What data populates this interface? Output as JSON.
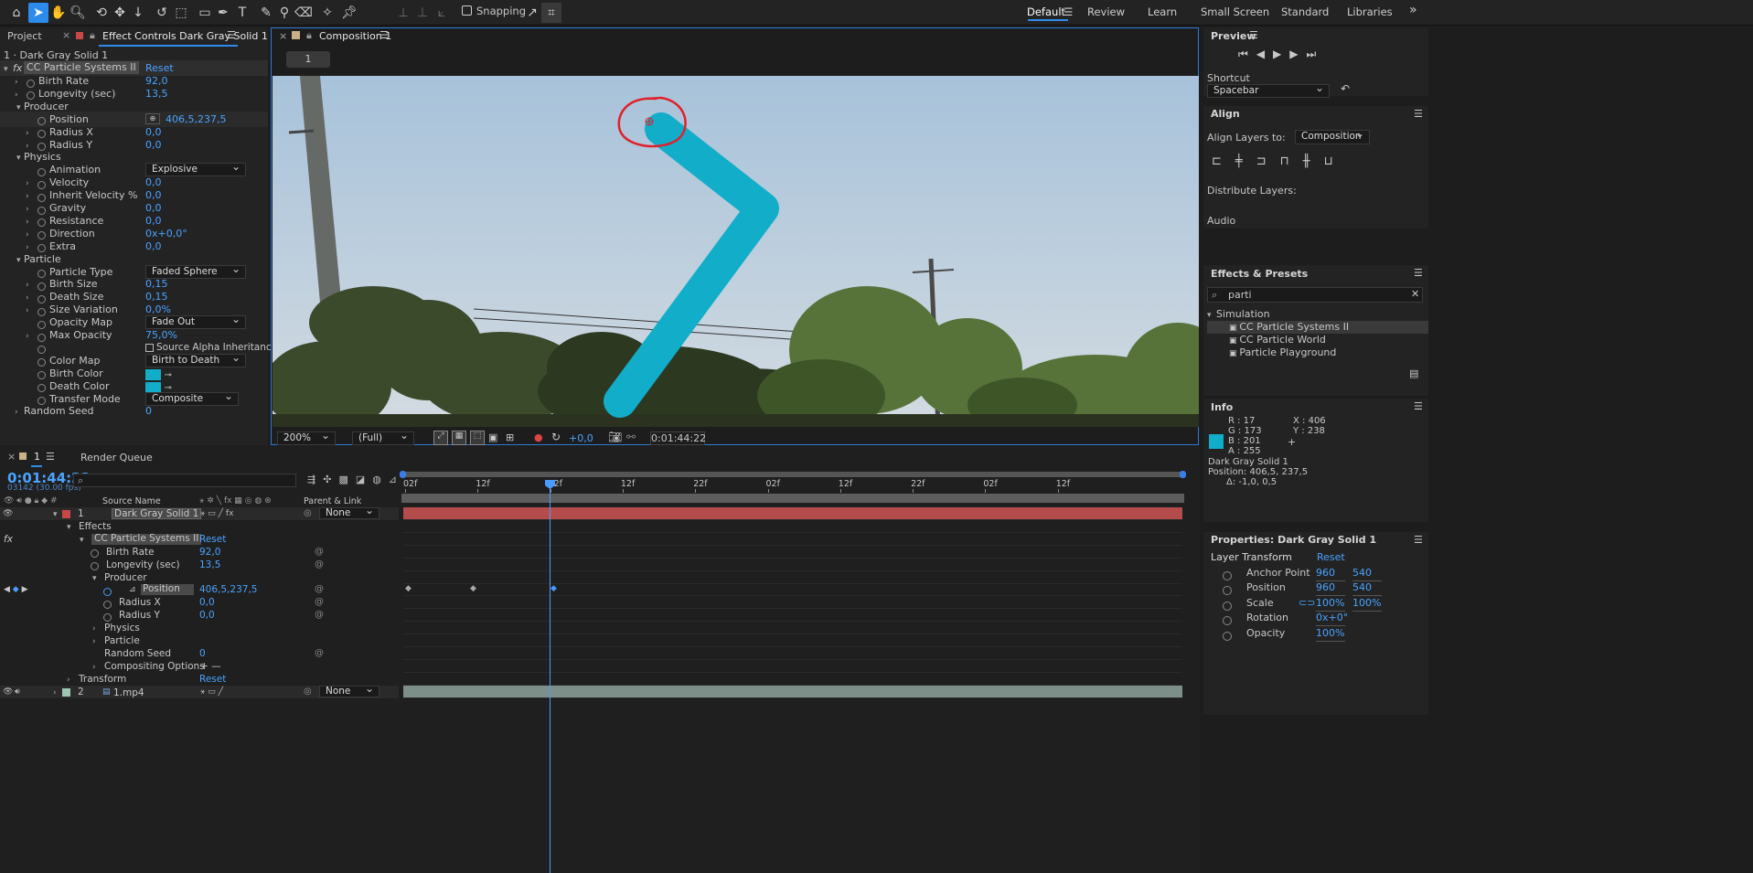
{
  "toolbar": {
    "snapping_label": "Snapping",
    "workspaces": [
      "Default",
      "Review",
      "Learn",
      "Small Screen",
      "Standard",
      "Libraries"
    ],
    "active_workspace": "Default"
  },
  "left_panel": {
    "tabs": [
      "Project",
      "Effect Controls Dark Gray Solid 1"
    ],
    "layer_name": "1 · Dark Gray Solid 1",
    "effect_name": "CC Particle Systems II",
    "reset_label": "Reset",
    "rows": [
      {
        "label": "Birth Rate",
        "value": "92,0",
        "indent": 1,
        "kind": "num"
      },
      {
        "label": "Longevity (sec)",
        "value": "13,5",
        "indent": 1,
        "kind": "num"
      },
      {
        "label": "Producer",
        "value": "",
        "indent": 0,
        "kind": "group"
      },
      {
        "label": "Position",
        "value": "406,5,237,5",
        "indent": 2,
        "kind": "pos"
      },
      {
        "label": "Radius X",
        "value": "0,0",
        "indent": 2,
        "kind": "num"
      },
      {
        "label": "Radius Y",
        "value": "0,0",
        "indent": 2,
        "kind": "num"
      },
      {
        "label": "Physics",
        "value": "",
        "indent": 0,
        "kind": "group"
      },
      {
        "label": "Animation",
        "value": "Explosive",
        "indent": 2,
        "kind": "dd"
      },
      {
        "label": "Velocity",
        "value": "0,0",
        "indent": 2,
        "kind": "num"
      },
      {
        "label": "Inherit Velocity %",
        "value": "0,0",
        "indent": 2,
        "kind": "num"
      },
      {
        "label": "Gravity",
        "value": "0,0",
        "indent": 2,
        "kind": "num"
      },
      {
        "label": "Resistance",
        "value": "0,0",
        "indent": 2,
        "kind": "num"
      },
      {
        "label": "Direction",
        "value": "0x+0,0°",
        "indent": 2,
        "kind": "num"
      },
      {
        "label": "Extra",
        "value": "0,0",
        "indent": 2,
        "kind": "num"
      },
      {
        "label": "Particle",
        "value": "",
        "indent": 0,
        "kind": "group"
      },
      {
        "label": "Particle Type",
        "value": "Faded Sphere",
        "indent": 2,
        "kind": "dd"
      },
      {
        "label": "Birth Size",
        "value": "0,15",
        "indent": 2,
        "kind": "num"
      },
      {
        "label": "Death Size",
        "value": "0,15",
        "indent": 2,
        "kind": "num"
      },
      {
        "label": "Size Variation",
        "value": "0,0%",
        "indent": 2,
        "kind": "num"
      },
      {
        "label": "Opacity Map",
        "value": "Fade Out",
        "indent": 2,
        "kind": "dd"
      },
      {
        "label": "Max Opacity",
        "value": "75,0%",
        "indent": 2,
        "kind": "num"
      },
      {
        "label": "",
        "value": "Source Alpha Inheritance",
        "indent": 2,
        "kind": "chk"
      },
      {
        "label": "Color Map",
        "value": "Birth to Death",
        "indent": 2,
        "kind": "dd"
      },
      {
        "label": "Birth Color",
        "value": "",
        "indent": 2,
        "kind": "color"
      },
      {
        "label": "Death Color",
        "value": "",
        "indent": 2,
        "kind": "color"
      },
      {
        "label": "Transfer Mode",
        "value": "Composite",
        "indent": 2,
        "kind": "dd"
      },
      {
        "label": "Random Seed",
        "value": "0",
        "indent": 0,
        "kind": "num"
      }
    ]
  },
  "viewer": {
    "tab": "Composition 1",
    "breadcrumb": "1",
    "zoom": "200%",
    "resolution": "(Full)",
    "exposure": "+0,0",
    "timecode": "0:01:44:22"
  },
  "preview": {
    "title": "Preview",
    "shortcut_label": "Shortcut",
    "shortcut_value": "Spacebar"
  },
  "align": {
    "title": "Align",
    "align_to_label": "Align Layers to:",
    "align_to_value": "Composition",
    "distribute_label": "Distribute Layers:",
    "audio_label": "Audio"
  },
  "effects_presets": {
    "title": "Effects & Presets",
    "search": "parti",
    "category": "Simulation",
    "items": [
      "CC Particle Systems II",
      "CC Particle World",
      "Particle Playground"
    ]
  },
  "info": {
    "title": "Info",
    "r": "R :  17",
    "g": "G :  173",
    "b": "B :  201",
    "a": "A :   255",
    "x": "X : 406",
    "y": "Y : 238",
    "layer": "Dark Gray Solid 1",
    "position": "Position: 406,5, 237,5",
    "delta": "Δ: -1,0, 0,5"
  },
  "properties": {
    "title": "Properties: Dark Gray Solid 1",
    "section": "Layer Transform",
    "reset": "Reset",
    "rows": [
      {
        "label": "Anchor Point",
        "v1": "960",
        "v2": "540"
      },
      {
        "label": "Position",
        "v1": "960",
        "v2": "540"
      },
      {
        "label": "Scale",
        "v1": "100%",
        "v2": "100%"
      },
      {
        "label": "Rotation",
        "v1": "0x+0°",
        "v2": ""
      },
      {
        "label": "Opacity",
        "v1": "100%",
        "v2": ""
      }
    ]
  },
  "timeline": {
    "tabs": [
      "1",
      "Render Queue"
    ],
    "timecode": "0:01:44:22",
    "frames": "03142 (30.00 fps)",
    "col_source": "Source Name",
    "col_parent": "Parent & Link",
    "ruler": [
      "02f",
      "12f",
      "02f",
      "12f",
      "22f",
      "02f",
      "12f",
      "22f",
      "02f",
      "12f"
    ],
    "rows": [
      {
        "num": "1",
        "label": "Dark Gray Solid 1",
        "value": "",
        "kind": "layer",
        "parent": "None"
      },
      {
        "num": "",
        "label": "Effects",
        "value": "",
        "kind": "group1"
      },
      {
        "num": "",
        "label": "CC Particle Systems II",
        "value": "Reset",
        "kind": "effect"
      },
      {
        "num": "",
        "label": "Birth Rate",
        "value": "92,0",
        "kind": "prop3"
      },
      {
        "num": "",
        "label": "Longevity (sec)",
        "value": "13,5",
        "kind": "prop3"
      },
      {
        "num": "",
        "label": "Producer",
        "value": "",
        "kind": "group3"
      },
      {
        "num": "",
        "label": "Position",
        "value": "406,5,237,5",
        "kind": "pos"
      },
      {
        "num": "",
        "label": "Radius X",
        "value": "0,0",
        "kind": "prop4"
      },
      {
        "num": "",
        "label": "Radius Y",
        "value": "0,0",
        "kind": "prop4"
      },
      {
        "num": "",
        "label": "Physics",
        "value": "",
        "kind": "group3c"
      },
      {
        "num": "",
        "label": "Particle",
        "value": "",
        "kind": "group3c"
      },
      {
        "num": "",
        "label": "Random Seed",
        "value": "0",
        "kind": "prop3"
      },
      {
        "num": "",
        "label": "Compositing Options",
        "value": "+ —",
        "kind": "group3c"
      },
      {
        "num": "",
        "label": "Transform",
        "value": "Reset",
        "kind": "group1c"
      },
      {
        "num": "2",
        "label": "1.mp4",
        "value": "",
        "kind": "layer2",
        "parent": "None"
      }
    ]
  }
}
